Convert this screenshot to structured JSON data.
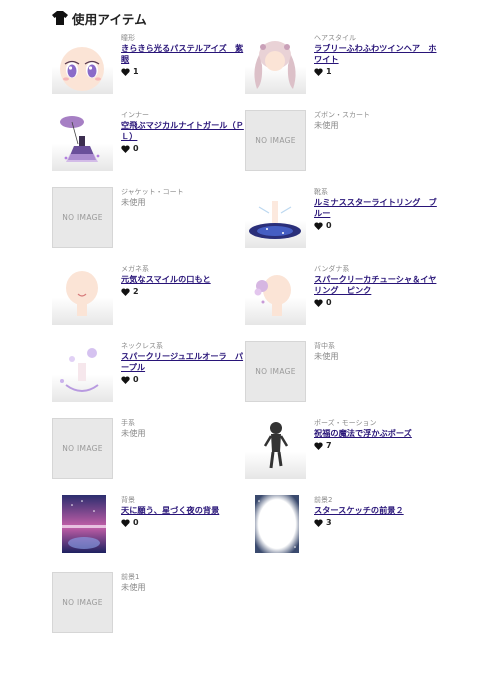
{
  "header": {
    "icon": "shirt-icon",
    "title": "使用アイテム"
  },
  "items": [
    {
      "category": "瞳形",
      "name": "きらきら光るパステルアイズ　紫眼",
      "likes": "1",
      "image": true
    },
    {
      "category": "ヘアスタイル",
      "name": "ラブリーふわふわツインヘア　ホワイト",
      "likes": "1",
      "image": true
    },
    {
      "category": "インナー",
      "name": "空飛ぶマジカルナイトガール（ＰＬ）",
      "likes": "0",
      "image": true
    },
    {
      "category": "ズボン・スカート",
      "unused": "未使用",
      "noimage": "NO IMAGE",
      "image": false
    },
    {
      "category": "ジャケット・コート",
      "unused": "未使用",
      "noimage": "NO IMAGE",
      "image": false
    },
    {
      "category": "靴系",
      "name": "ルミナススターライトリング　ブルー",
      "likes": "0",
      "image": true
    },
    {
      "category": "メガネ系",
      "name": "元気なスマイルの口もと",
      "likes": "2",
      "image": true
    },
    {
      "category": "バンダナ系",
      "name": "スパークリーカチューシャ＆イヤリング　ピンク",
      "likes": "0",
      "image": true
    },
    {
      "category": "ネックレス系",
      "name": "スパークリージュエルオーラ　パープル",
      "likes": "0",
      "image": true
    },
    {
      "category": "背中系",
      "unused": "未使用",
      "noimage": "NO IMAGE",
      "image": false
    },
    {
      "category": "手系",
      "unused": "未使用",
      "noimage": "NO IMAGE",
      "image": false
    },
    {
      "category": "ポーズ・モーション",
      "name": "祝福の魔法で浮かぶポーズ",
      "likes": "7",
      "image": true
    },
    {
      "category": "背景",
      "name": "天に願う、星づく夜の背景",
      "likes": "0",
      "image": true
    },
    {
      "category": "前景2",
      "name": "スタースケッチの前景２",
      "likes": "3",
      "image": true
    },
    {
      "category": "前景1",
      "unused": "未使用",
      "noimage": "NO IMAGE",
      "image": false
    }
  ],
  "colors": {
    "link": "#281478",
    "muted": "#8a8a8a",
    "noimage_bg": "#e8e8e8"
  }
}
